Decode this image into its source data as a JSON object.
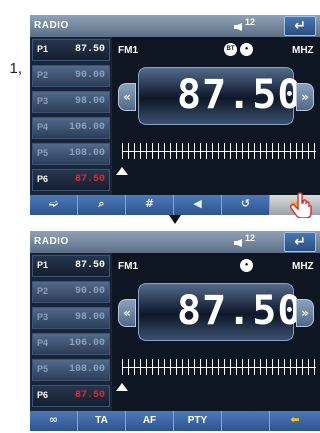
{
  "page_number": "1,",
  "screens": [
    {
      "title": "RADIO",
      "volume": "12",
      "band": "FM1",
      "badges": [
        "BT",
        "●"
      ],
      "unit": "MHZ",
      "frequency": "87.50",
      "presets": [
        {
          "label": "P1",
          "freq": "87.50",
          "active": true
        },
        {
          "label": "P2",
          "freq": "90.00",
          "active": false
        },
        {
          "label": "P3",
          "freq": "98.00",
          "active": false
        },
        {
          "label": "P4",
          "freq": "106.00",
          "active": false
        },
        {
          "label": "P5",
          "freq": "108.00",
          "active": false
        },
        {
          "label": "P6",
          "freq": "87.50",
          "active": true,
          "current": true
        }
      ],
      "buttons": [
        {
          "icon": "seek-icon",
          "glyph": "➫",
          "label": ""
        },
        {
          "icon": "search-icon",
          "glyph": "⌕",
          "label": ""
        },
        {
          "icon": "preset-scan-icon",
          "glyph": "#",
          "label": ""
        },
        {
          "icon": "speaker-icon",
          "glyph": "◀",
          "label": ""
        },
        {
          "icon": "rotate-icon",
          "glyph": "↺",
          "label": ""
        },
        {
          "icon": "next-page-arrow-icon",
          "glyph": "➡",
          "label": ""
        }
      ]
    },
    {
      "title": "RADIO",
      "volume": "12",
      "band": "FM1",
      "badges": [
        "●"
      ],
      "unit": "MHZ",
      "frequency": "87.50",
      "presets": [
        {
          "label": "P1",
          "freq": "87.50",
          "active": true
        },
        {
          "label": "P2",
          "freq": "90.00",
          "active": false
        },
        {
          "label": "P3",
          "freq": "98.00",
          "active": false
        },
        {
          "label": "P4",
          "freq": "106.00",
          "active": false
        },
        {
          "label": "P5",
          "freq": "108.00",
          "active": false
        },
        {
          "label": "P6",
          "freq": "87.50",
          "active": true,
          "current": true
        }
      ],
      "buttons": [
        {
          "icon": "stereo-icon",
          "glyph": "∞",
          "label": ""
        },
        {
          "icon": "",
          "glyph": "",
          "label": "TA"
        },
        {
          "icon": "",
          "glyph": "",
          "label": "AF"
        },
        {
          "icon": "",
          "glyph": "",
          "label": "PTY"
        },
        {
          "icon": "",
          "glyph": "",
          "label": ""
        },
        {
          "icon": "back-arrow-icon",
          "glyph": "⬅",
          "label": ""
        }
      ]
    }
  ],
  "colors": {
    "accent": "#2d5590",
    "current_preset": "#e3262a"
  }
}
